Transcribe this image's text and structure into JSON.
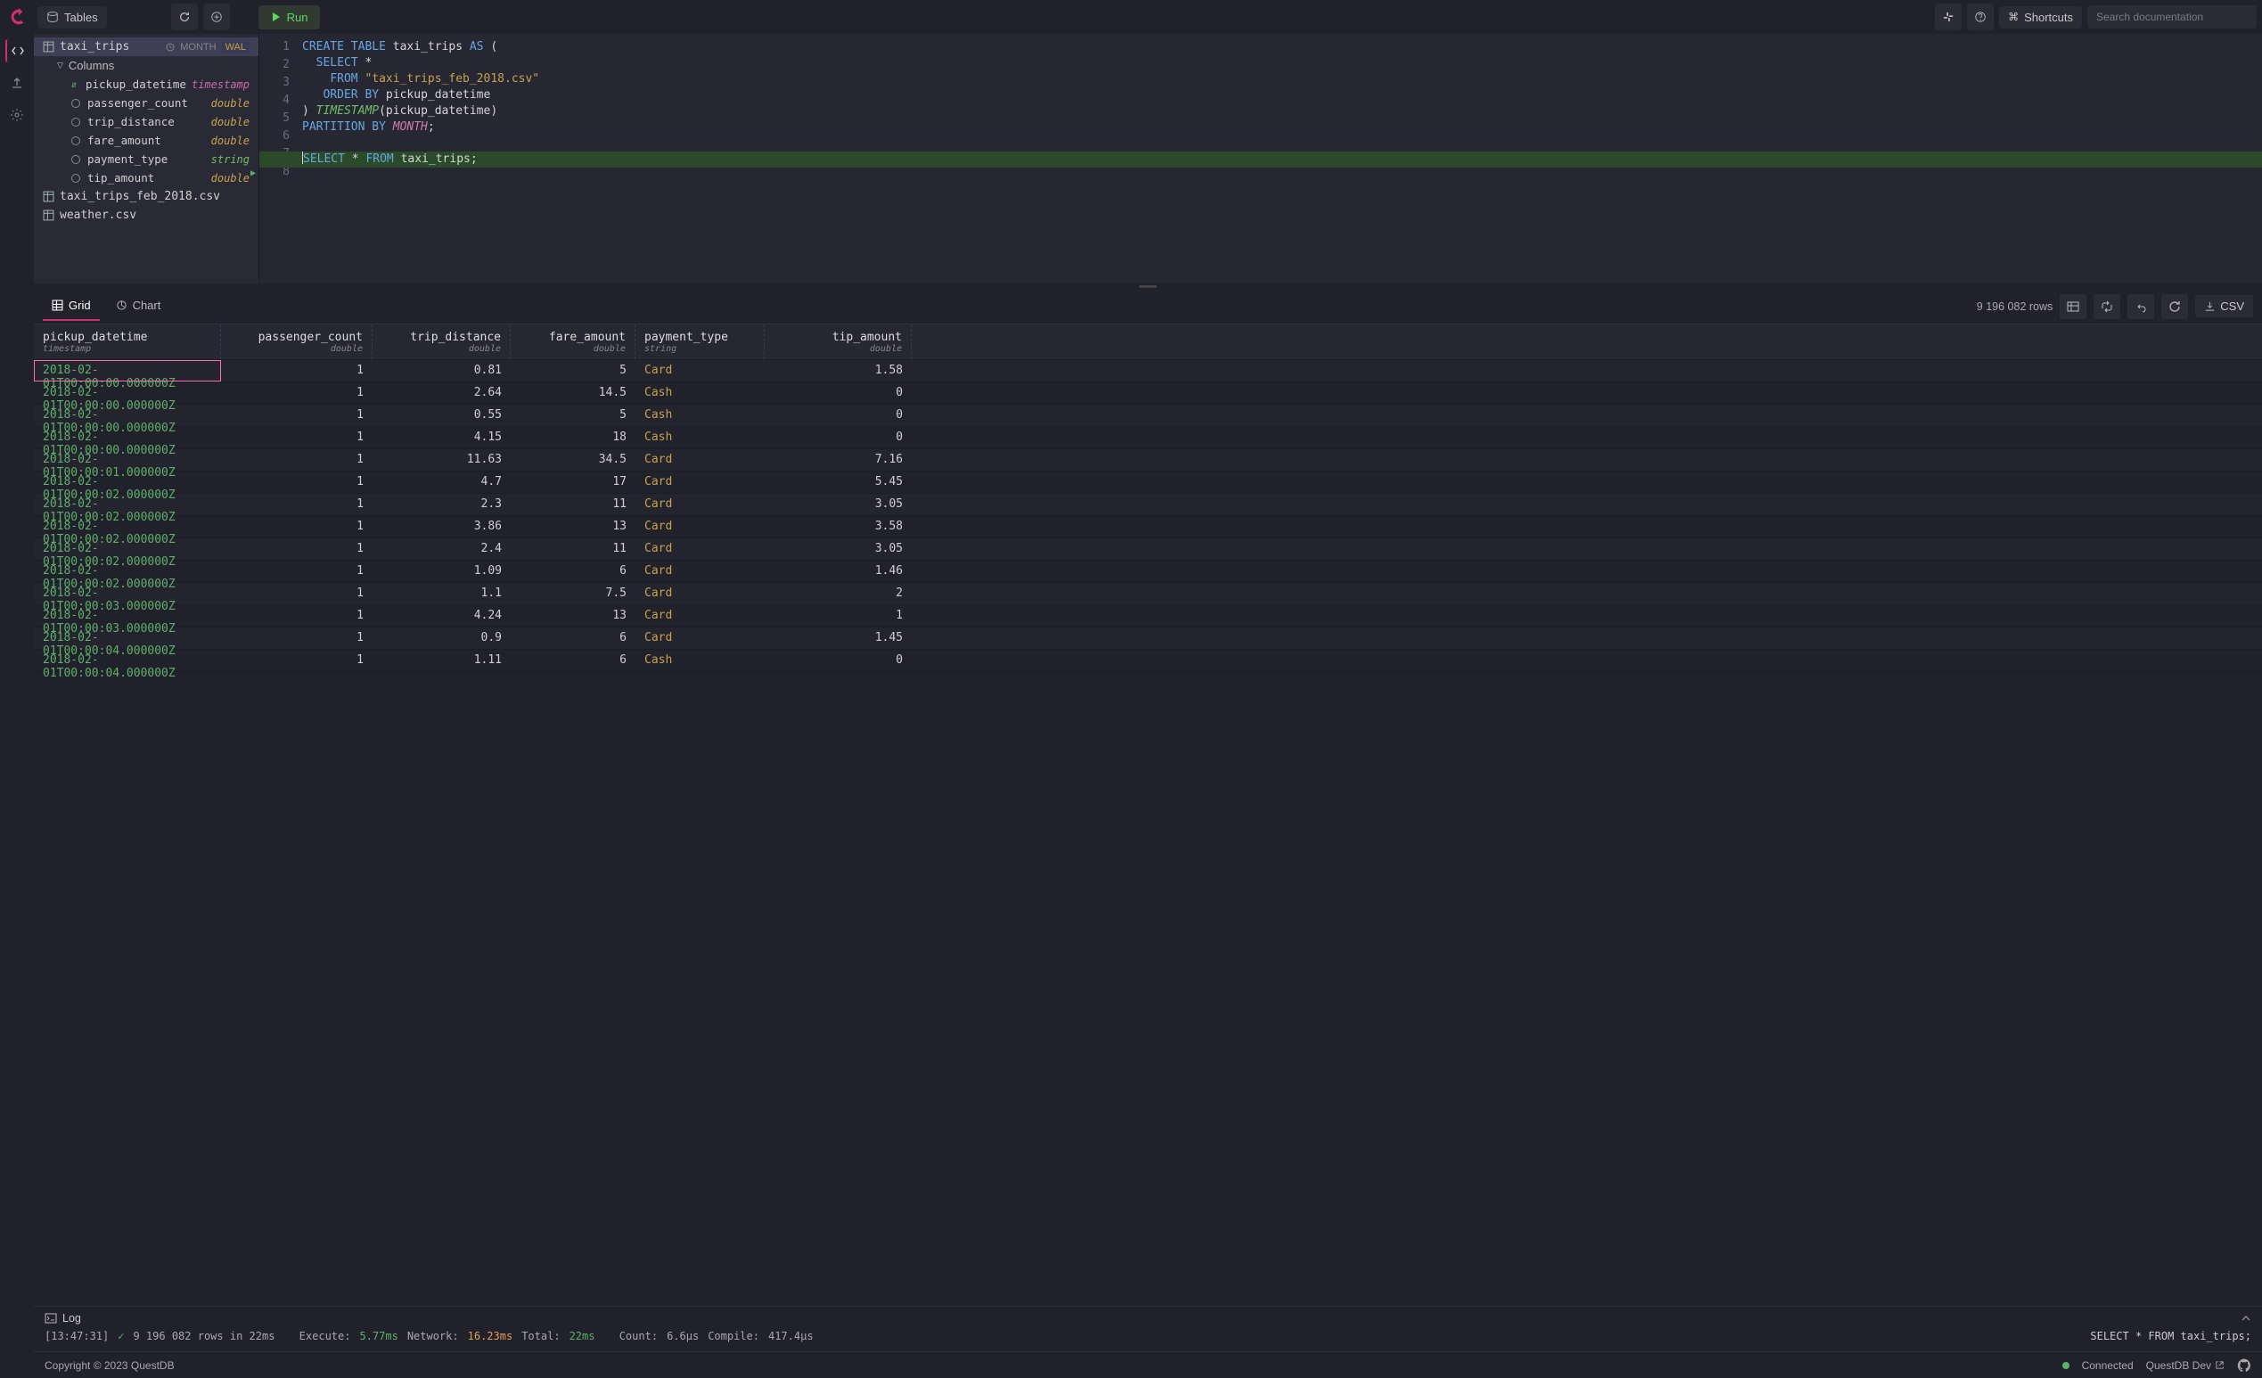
{
  "topbar": {
    "tables_label": "Tables",
    "run_label": "Run",
    "shortcuts_label": "Shortcuts",
    "search_placeholder": "Search documentation"
  },
  "siderail": [
    "code",
    "export",
    "settings"
  ],
  "tree": {
    "tables": [
      {
        "name": "taxi_trips",
        "badge_left": "MONTH",
        "badge_right": "WAL",
        "expanded": true,
        "selected": true,
        "group_label": "Columns",
        "columns": [
          {
            "name": "pickup_datetime",
            "type": "timestamp",
            "type_class": "type-ts",
            "ts": true
          },
          {
            "name": "passenger_count",
            "type": "double",
            "type_class": "type-d"
          },
          {
            "name": "trip_distance",
            "type": "double",
            "type_class": "type-d"
          },
          {
            "name": "fare_amount",
            "type": "double",
            "type_class": "type-d"
          },
          {
            "name": "payment_type",
            "type": "string",
            "type_class": "type-s"
          },
          {
            "name": "tip_amount",
            "type": "double",
            "type_class": "type-d"
          }
        ]
      },
      {
        "name": "taxi_trips_feb_2018.csv"
      },
      {
        "name": "weather.csv"
      }
    ]
  },
  "editor": {
    "lines": [
      [
        {
          "t": "CREATE TABLE",
          "c": "kw-blue"
        },
        {
          "t": " taxi_trips ",
          "c": "kw-id"
        },
        {
          "t": "AS",
          "c": "kw-blue"
        },
        {
          "t": " (",
          "c": "kw-id"
        }
      ],
      [
        {
          "t": "  ",
          "c": ""
        },
        {
          "t": "SELECT",
          "c": "kw-blue"
        },
        {
          "t": " *",
          "c": "kw-id"
        }
      ],
      [
        {
          "t": "    ",
          "c": ""
        },
        {
          "t": "FROM",
          "c": "kw-blue"
        },
        {
          "t": " ",
          "c": ""
        },
        {
          "t": "\"taxi_trips_feb_2018.csv\"",
          "c": "kw-str"
        }
      ],
      [
        {
          "t": "   ",
          "c": ""
        },
        {
          "t": "ORDER BY",
          "c": "kw-blue"
        },
        {
          "t": " pickup_datetime",
          "c": "kw-id"
        }
      ],
      [
        {
          "t": ") ",
          "c": "kw-id"
        },
        {
          "t": "TIMESTAMP",
          "c": "kw-green"
        },
        {
          "t": "(pickup_datetime)",
          "c": "kw-id"
        }
      ],
      [
        {
          "t": "PARTITION BY",
          "c": "kw-blue"
        },
        {
          "t": " ",
          "c": ""
        },
        {
          "t": "MONTH",
          "c": "kw-pink"
        },
        {
          "t": ";",
          "c": "kw-id"
        }
      ],
      [],
      [
        {
          "t": "SELECT",
          "c": "kw-blue"
        },
        {
          "t": " * ",
          "c": "kw-id"
        },
        {
          "t": "FROM",
          "c": "kw-blue"
        },
        {
          "t": " taxi_trips;",
          "c": "kw-id"
        }
      ]
    ],
    "active_line": 8
  },
  "results": {
    "grid_tab": "Grid",
    "chart_tab": "Chart",
    "row_count_text": "9 196 082 rows",
    "csv_label": "CSV",
    "columns": [
      {
        "name": "pickup_datetime",
        "type": "timestamp",
        "cls": "c1",
        "align": "left"
      },
      {
        "name": "passenger_count",
        "type": "double",
        "cls": "c2",
        "align": "right"
      },
      {
        "name": "trip_distance",
        "type": "double",
        "cls": "c3",
        "align": "right"
      },
      {
        "name": "fare_amount",
        "type": "double",
        "cls": "c4",
        "align": "right"
      },
      {
        "name": "payment_type",
        "type": "string",
        "cls": "c5",
        "align": "left"
      },
      {
        "name": "tip_amount",
        "type": "double",
        "cls": "c6",
        "align": "right"
      }
    ],
    "rows": [
      [
        "2018-02-01T00:00:00.000000Z",
        "1",
        "0.81",
        "5",
        "Card",
        "1.58"
      ],
      [
        "2018-02-01T00:00:00.000000Z",
        "1",
        "2.64",
        "14.5",
        "Cash",
        "0"
      ],
      [
        "2018-02-01T00:00:00.000000Z",
        "1",
        "0.55",
        "5",
        "Cash",
        "0"
      ],
      [
        "2018-02-01T00:00:00.000000Z",
        "1",
        "4.15",
        "18",
        "Cash",
        "0"
      ],
      [
        "2018-02-01T00:00:01.000000Z",
        "1",
        "11.63",
        "34.5",
        "Card",
        "7.16"
      ],
      [
        "2018-02-01T00:00:02.000000Z",
        "1",
        "4.7",
        "17",
        "Card",
        "5.45"
      ],
      [
        "2018-02-01T00:00:02.000000Z",
        "1",
        "2.3",
        "11",
        "Card",
        "3.05"
      ],
      [
        "2018-02-01T00:00:02.000000Z",
        "1",
        "3.86",
        "13",
        "Card",
        "3.58"
      ],
      [
        "2018-02-01T00:00:02.000000Z",
        "1",
        "2.4",
        "11",
        "Card",
        "3.05"
      ],
      [
        "2018-02-01T00:00:02.000000Z",
        "1",
        "1.09",
        "6",
        "Card",
        "1.46"
      ],
      [
        "2018-02-01T00:00:03.000000Z",
        "1",
        "1.1",
        "7.5",
        "Card",
        "2"
      ],
      [
        "2018-02-01T00:00:03.000000Z",
        "1",
        "4.24",
        "13",
        "Card",
        "1"
      ],
      [
        "2018-02-01T00:00:04.000000Z",
        "1",
        "0.9",
        "6",
        "Card",
        "1.45"
      ],
      [
        "2018-02-01T00:00:04.000000Z",
        "1",
        "1.11",
        "6",
        "Cash",
        "0"
      ]
    ],
    "selected_row": 0
  },
  "log": {
    "title": "Log",
    "time": "[13:47:31]",
    "rows_text": "9 196 082 rows in 22ms",
    "exec_label": "Execute:",
    "exec_val": "5.77ms",
    "net_label": "Network:",
    "net_val": "16.23ms",
    "tot_label": "Total:",
    "tot_val": "22ms",
    "count_label": "Count:",
    "count_val": "6.6µs",
    "compile_label": "Compile:",
    "compile_val": "417.4µs",
    "sql": "SELECT * FROM taxi_trips;"
  },
  "footer": {
    "copyright": "Copyright © 2023 QuestDB",
    "connected": "Connected",
    "devlink": "QuestDB Dev"
  }
}
